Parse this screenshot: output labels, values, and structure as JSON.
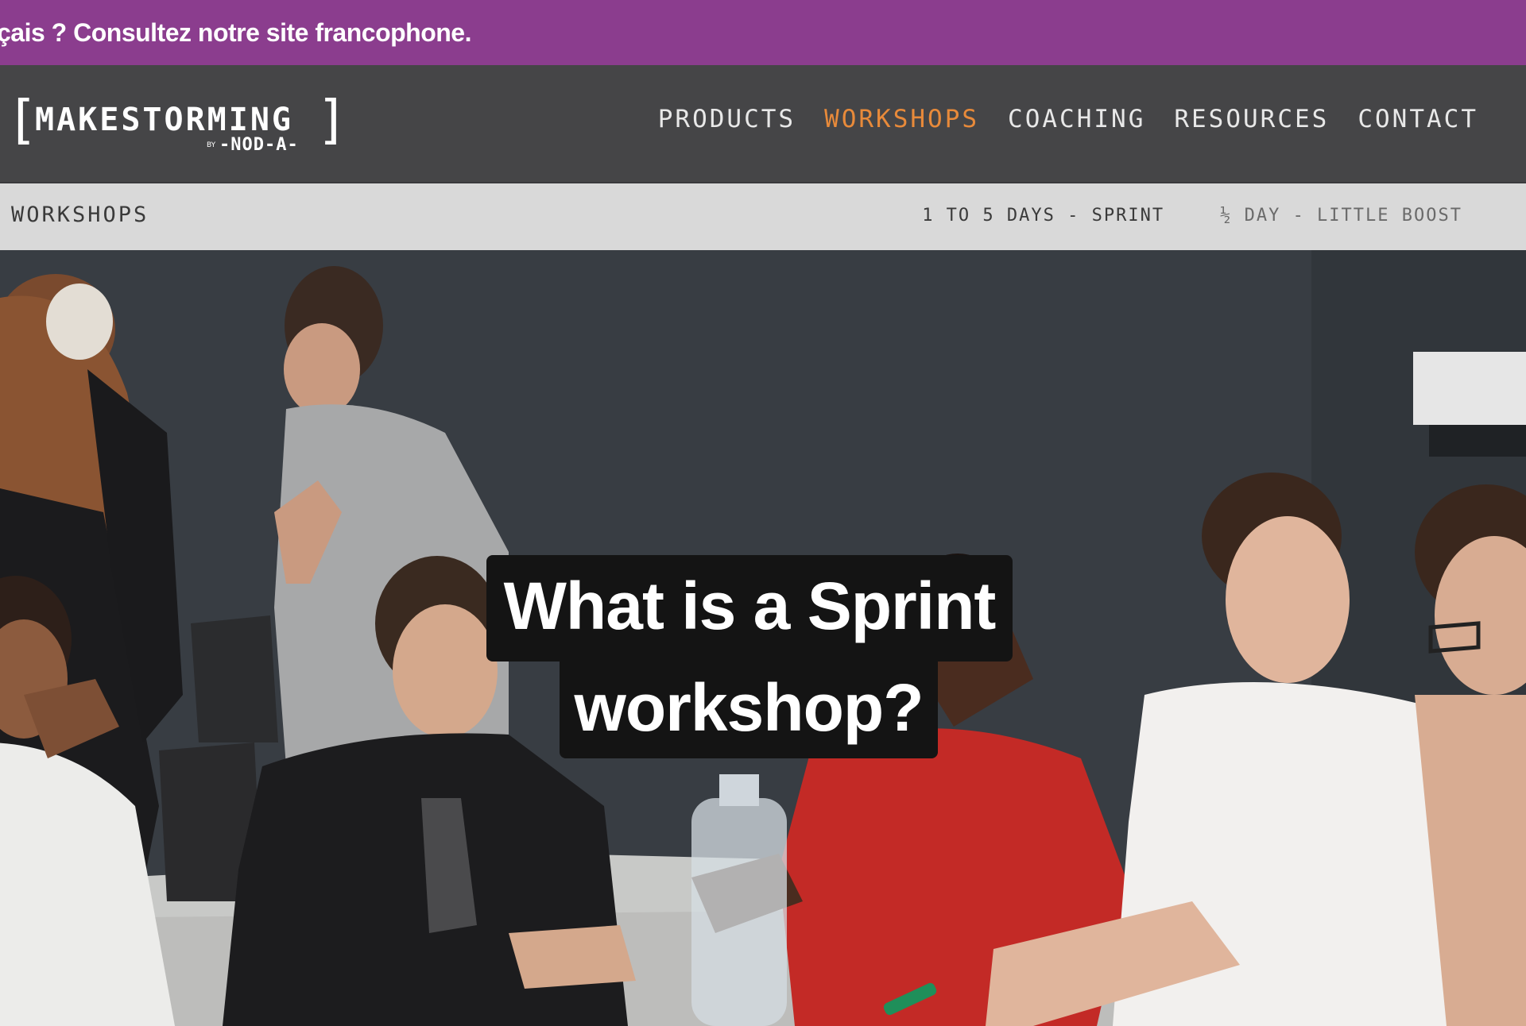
{
  "banner": {
    "text": "çais ? Consultez notre site francophone."
  },
  "logo": {
    "left_bracket": "[",
    "word": "MAKESTORMING",
    "right_bracket": "]",
    "by": "BY",
    "sub": "-NOD-A-"
  },
  "nav": {
    "items": [
      {
        "label": "PRODUCTS"
      },
      {
        "label": "WORKSHOPS"
      },
      {
        "label": "COACHING"
      },
      {
        "label": "RESOURCES"
      },
      {
        "label": "CONTACT"
      }
    ],
    "active": "WORKSHOPS"
  },
  "subnav": {
    "section": "WORKSHOPS",
    "links": [
      {
        "label": "1 TO 5 DAYS - SPRINT"
      },
      {
        "label": "½ DAY - LITTLE BOOST"
      }
    ]
  },
  "hero": {
    "title_line1": "What is a Sprint",
    "title_line2": "workshop?"
  },
  "colors": {
    "banner": "#8b3d8e",
    "header": "#454547",
    "active_nav": "#e88a3a",
    "subnav": "#d9d9d9",
    "title_box": "#141414"
  }
}
